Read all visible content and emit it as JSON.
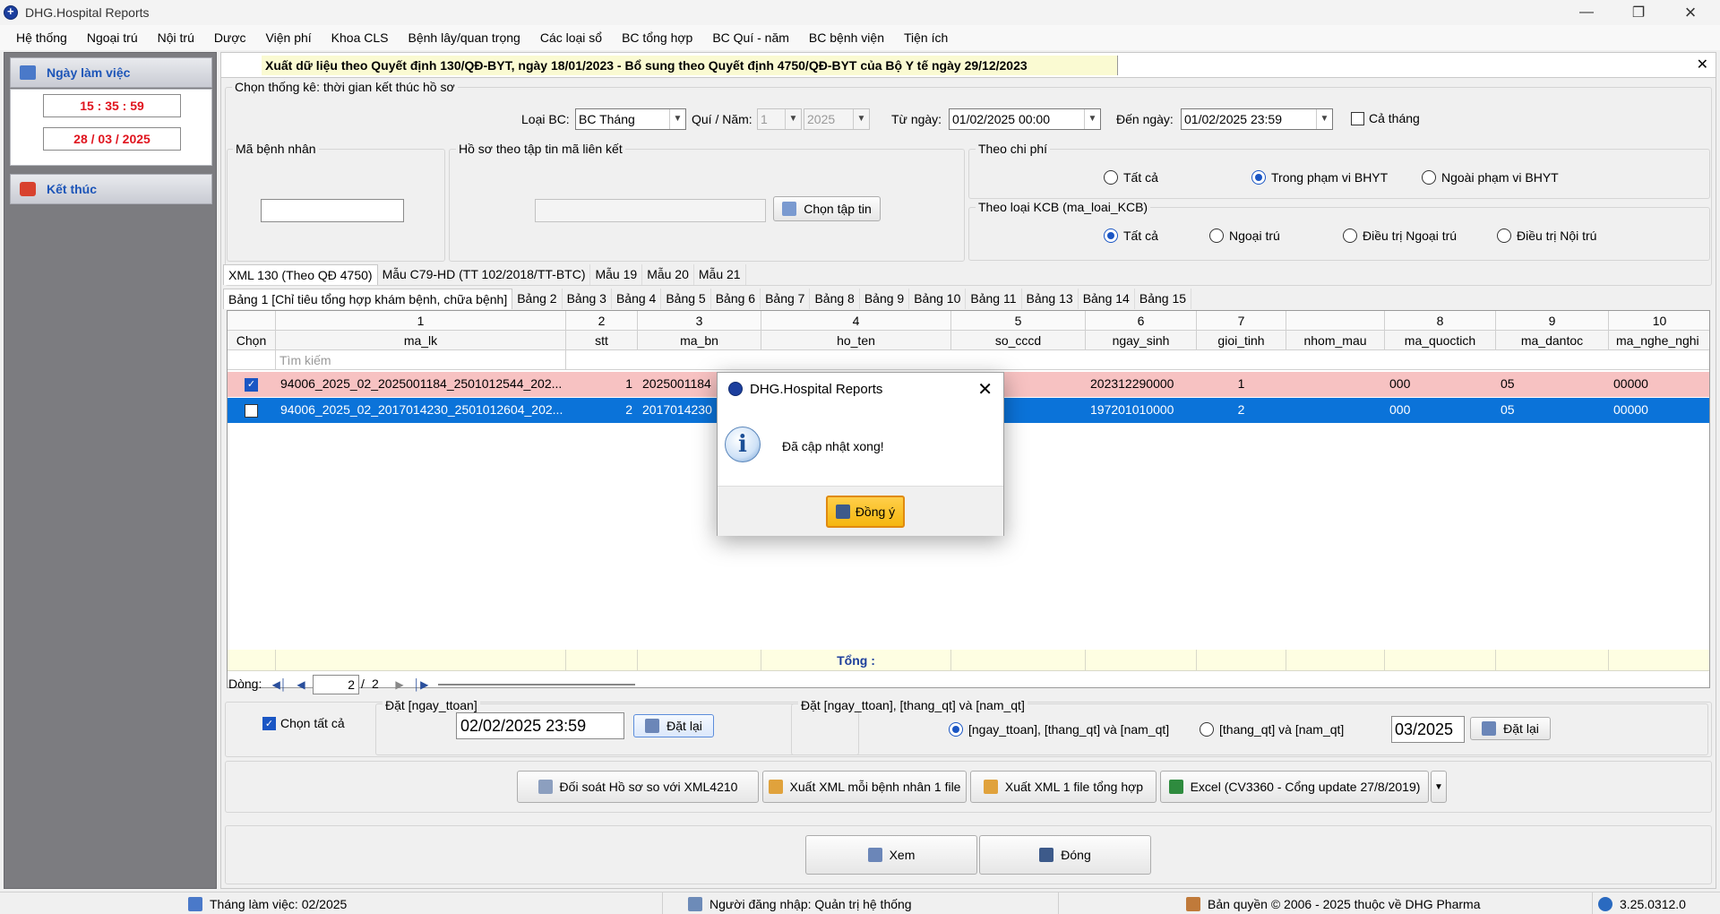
{
  "window": {
    "title": "DHG.Hospital Reports"
  },
  "menu": [
    "Hệ thống",
    "Ngoại trú",
    "Nội trú",
    "Dược",
    "Viện phí",
    "Khoa CLS",
    "Bệnh lây/quan trọng",
    "Các loại sổ",
    "BC tổng hợp",
    "BC Quí - năm",
    "BC bệnh viện",
    "Tiện ích"
  ],
  "left": {
    "workday_title": "Ngày làm việc",
    "time": "15 : 35 : 59",
    "date": "28 / 03 / 2025",
    "exit_label": "Kết thúc"
  },
  "header": {
    "title": "Xuất dữ liệu theo Quyết định 130/QĐ-BYT, ngày 18/01/2023 - Bổ sung theo Quyết định 4750/QĐ-BYT của Bộ Y tế ngày 29/12/2023"
  },
  "filters": {
    "group_label": "Chọn thống kê: thời gian kết thúc hồ sơ",
    "report_type_label": "Loại BC:",
    "report_type": "BC Tháng",
    "quarter_year_label": "Quí / Năm:",
    "quarter": "1",
    "year": "2025",
    "from_label": "Từ ngày:",
    "from": "01/02/2025 00:00",
    "to_label": "Đến ngày:",
    "to": "01/02/2025 23:59",
    "whole_month_label": "Cả tháng",
    "patient_id_label": "Mã bệnh nhân",
    "file_group_label": "Hồ sơ theo tập tin mã liên kết",
    "choose_file_label": "Chọn tập tin",
    "cost_group_label": "Theo chi phí",
    "cost_options": [
      "Tất cả",
      "Trong phạm vi BHYT",
      "Ngoài phạm vi BHYT"
    ],
    "kcb_group_label": "Theo loại KCB (ma_loai_KCB)",
    "kcb_options": [
      "Tất cả",
      "Ngoại trú",
      "Điều trị Ngoại trú",
      "Điều trị Nội trú"
    ]
  },
  "tabs_top": [
    "XML 130 (Theo QĐ 4750)",
    "Mẫu C79-HD (TT 102/2018/TT-BTC)",
    "Mẫu 19",
    "Mẫu 20",
    "Mẫu 21"
  ],
  "tabs_table": [
    "Bảng 1 [Chỉ tiêu tổng hợp khám bệnh, chữa bệnh]",
    "Bảng 2",
    "Bảng 3",
    "Bảng 4",
    "Bảng 5",
    "Bảng 6",
    "Bảng 7",
    "Bảng 8",
    "Bảng 9",
    "Bảng 10",
    "Bảng 11",
    "Bảng 13",
    "Bảng 14",
    "Bảng 15"
  ],
  "grid": {
    "col_numbers": [
      "",
      "1",
      "2",
      "3",
      "4",
      "5",
      "6",
      "7",
      "",
      "8",
      "9",
      "10"
    ],
    "columns": [
      "Chọn",
      "ma_lk",
      "stt",
      "ma_bn",
      "ho_ten",
      "so_cccd",
      "ngay_sinh",
      "gioi_tinh",
      "nhom_mau",
      "ma_quoctich",
      "ma_dantoc",
      "ma_nghe_nghi"
    ],
    "search_placeholder": "Tìm kiếm",
    "rows": [
      {
        "checked": true,
        "ma_lk": "94006_2025_02_2025001184_2501012544_202...",
        "stt": "1",
        "ma_bn": "2025001184",
        "ngay_sinh": "202312290000",
        "gioi_tinh": "1",
        "ma_quoctich": "000",
        "ma_dantoc": "05",
        "ma_nghe": "00000"
      },
      {
        "checked": false,
        "ma_lk": "94006_2025_02_2017014230_2501012604_202...",
        "stt": "2",
        "ma_bn": "2017014230",
        "ngay_sinh": "197201010000",
        "gioi_tinh": "2",
        "ma_quoctich": "000",
        "ma_dantoc": "05",
        "ma_nghe": "00000"
      }
    ],
    "total_label": "Tổng :"
  },
  "pager": {
    "label": "Dòng:",
    "current": "2",
    "sep": "/",
    "total": "2"
  },
  "bottom": {
    "select_all_label": "Chọn tất cả",
    "set_ttoan_group": "Đặt [ngay_ttoan]",
    "set_ttoan_value": "02/02/2025 23:59",
    "reset_label": "Đặt lại",
    "set_all_group": "Đặt  [ngay_ttoan], [thang_qt] và [nam_qt]",
    "radio_all": "[ngay_ttoan], [thang_qt] và [nam_qt]",
    "radio_month": "[thang_qt] và [nam_qt]",
    "month_value": "03/2025",
    "reset_label2": "Đặt lại",
    "btn_compare": "Đối soát Hồ sơ so với XML4210",
    "btn_xml_each": "Xuất XML mỗi bệnh nhân 1 file",
    "btn_xml_one": "Xuất XML 1 file tổng hợp",
    "btn_excel": "Excel (CV3360 - Cổng update 27/8/2019)",
    "btn_view": "Xem",
    "btn_close": "Đóng"
  },
  "dialog": {
    "title": "DHG.Hospital Reports",
    "message": "Đã cập nhật xong!",
    "ok_label": "Đồng ý"
  },
  "status": {
    "month": "Tháng làm việc: 02/2025",
    "user": "Người đăng nhập: Quản trị hệ thống",
    "copyright": "Bản quyền © 2006 - 2025 thuộc về DHG Pharma",
    "version": "3.25.0312.0"
  },
  "colors": {
    "accent": "#0b73d9",
    "highlight_row": "#f7c2c2",
    "clock_red": "#e0141e"
  }
}
